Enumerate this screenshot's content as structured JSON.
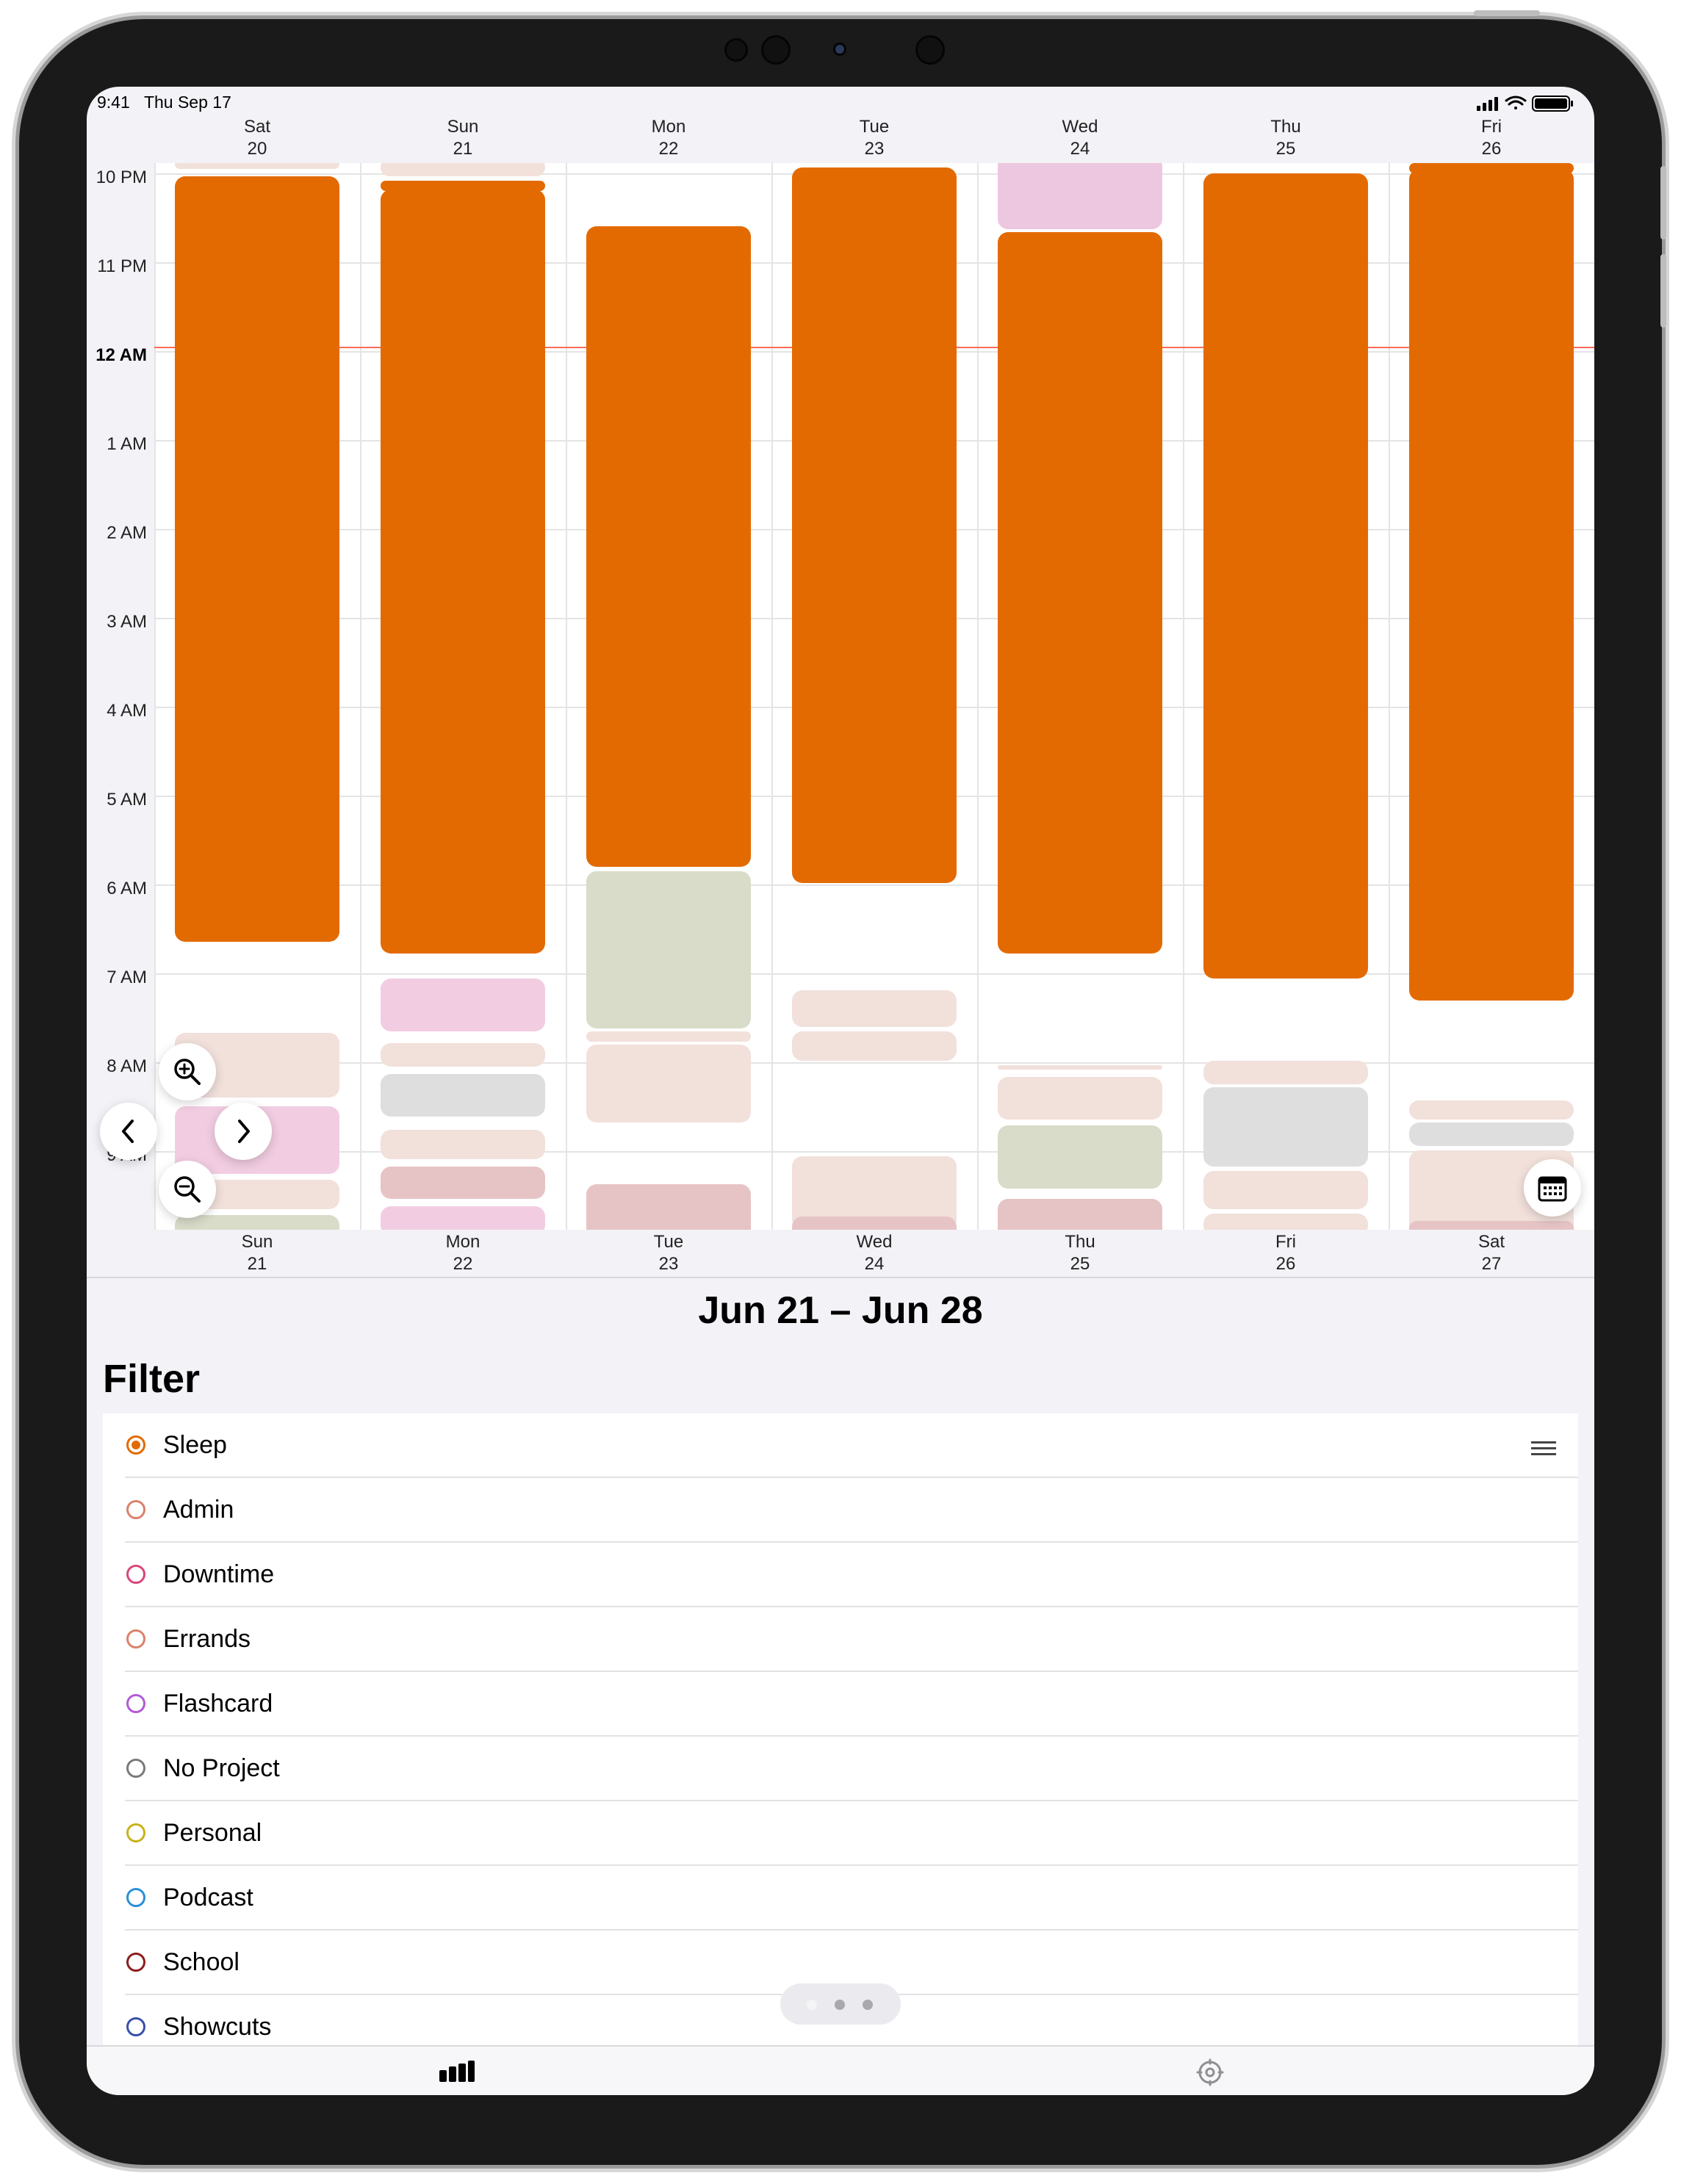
{
  "status": {
    "time": "9:41",
    "date": "Thu Sep 17"
  },
  "top_days": [
    {
      "name": "Sat",
      "num": "20"
    },
    {
      "name": "Sun",
      "num": "21"
    },
    {
      "name": "Mon",
      "num": "22"
    },
    {
      "name": "Tue",
      "num": "23"
    },
    {
      "name": "Wed",
      "num": "24"
    },
    {
      "name": "Thu",
      "num": "25"
    },
    {
      "name": "Fri",
      "num": "26"
    }
  ],
  "bottom_days": [
    {
      "name": "Sun",
      "num": "21"
    },
    {
      "name": "Mon",
      "num": "22"
    },
    {
      "name": "Tue",
      "num": "23"
    },
    {
      "name": "Wed",
      "num": "24"
    },
    {
      "name": "Thu",
      "num": "25"
    },
    {
      "name": "Fri",
      "num": "26"
    },
    {
      "name": "Sat",
      "num": "27"
    }
  ],
  "time_labels": [
    "10 PM",
    "11 PM",
    "12 AM",
    "1 AM",
    "2 AM",
    "3 AM",
    "4 AM",
    "5 AM",
    "6 AM",
    "7 AM",
    "8 AM",
    "9 AM"
  ],
  "range_title": "Jun 21 – Jun 28",
  "filter_title": "Filter",
  "filters": [
    {
      "label": "Sleep",
      "color": "#e36a00",
      "selected": true
    },
    {
      "label": "Admin",
      "color": "#d9826b",
      "selected": false
    },
    {
      "label": "Downtime",
      "color": "#d9467b",
      "selected": false
    },
    {
      "label": "Errands",
      "color": "#d9826b",
      "selected": false
    },
    {
      "label": "Flashcard",
      "color": "#b05bd6",
      "selected": false
    },
    {
      "label": "No Project",
      "color": "#7a7a7a",
      "selected": false
    },
    {
      "label": "Personal",
      "color": "#c9b21e",
      "selected": false
    },
    {
      "label": "Podcast",
      "color": "#2a8fd6",
      "selected": false
    },
    {
      "label": "School",
      "color": "#8c1d1d",
      "selected": false
    },
    {
      "label": "Showcuts",
      "color": "#3a50a8",
      "selected": false
    }
  ],
  "icons": {
    "zoom_in": "zoom-in-icon",
    "zoom_out": "zoom-out-icon",
    "prev": "chevron-left-icon",
    "next": "chevron-right-icon",
    "calendar": "calendar-icon",
    "reorder": "reorder-handle-icon",
    "tab_stats": "bar-chart-icon",
    "tab_settings": "gear-icon"
  },
  "colors": {
    "sleep": "#e36a00",
    "now_line": "#ff6b57"
  }
}
